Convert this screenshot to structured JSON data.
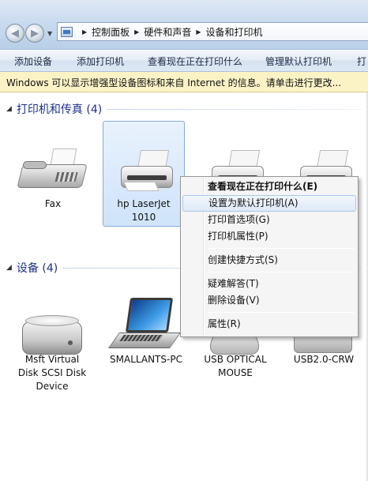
{
  "address": {
    "crumbs": [
      "控制面板",
      "硬件和声音",
      "设备和打印机"
    ]
  },
  "toolbar": {
    "commands": [
      "添加设备",
      "添加打印机",
      "查看现在正在打印什么",
      "管理默认打印机",
      "打"
    ]
  },
  "infobar": {
    "text": "Windows 可以显示增强型设备图标和来自 Internet 的信息。请单击进行更改..."
  },
  "groups": {
    "printers": {
      "title": "打印机和传真 (4)"
    },
    "devices": {
      "title": "设备 (4)"
    }
  },
  "printers": [
    {
      "label": "Fax",
      "icon": "fax-icon"
    },
    {
      "label": "hp LaserJet 1010",
      "icon": "printer-icon",
      "selected": true
    },
    {
      "label": "",
      "icon": "printer-icon"
    },
    {
      "label": "",
      "icon": "printer-icon"
    }
  ],
  "devices": [
    {
      "label": "Msft Virtual Disk SCSI Disk Device",
      "icon": "disk-drive-icon"
    },
    {
      "label": "SMALLANTS-PC",
      "icon": "laptop-icon"
    },
    {
      "label": "USB OPTICAL MOUSE",
      "icon": "mouse-icon"
    },
    {
      "label": "USB2.0-CRW",
      "icon": "usb-device-icon"
    }
  ],
  "context_menu": {
    "items": [
      {
        "label": "查看现在正在打印什么(E)",
        "bold": true
      },
      {
        "label": "设置为默认打印机(A)",
        "hover": true
      },
      {
        "label": "打印首选项(G)"
      },
      {
        "label": "打印机属性(P)"
      },
      {
        "label": "创建快捷方式(S)"
      },
      {
        "label": "疑难解答(T)"
      },
      {
        "label": "删除设备(V)"
      },
      {
        "label": "属性(R)"
      }
    ]
  }
}
